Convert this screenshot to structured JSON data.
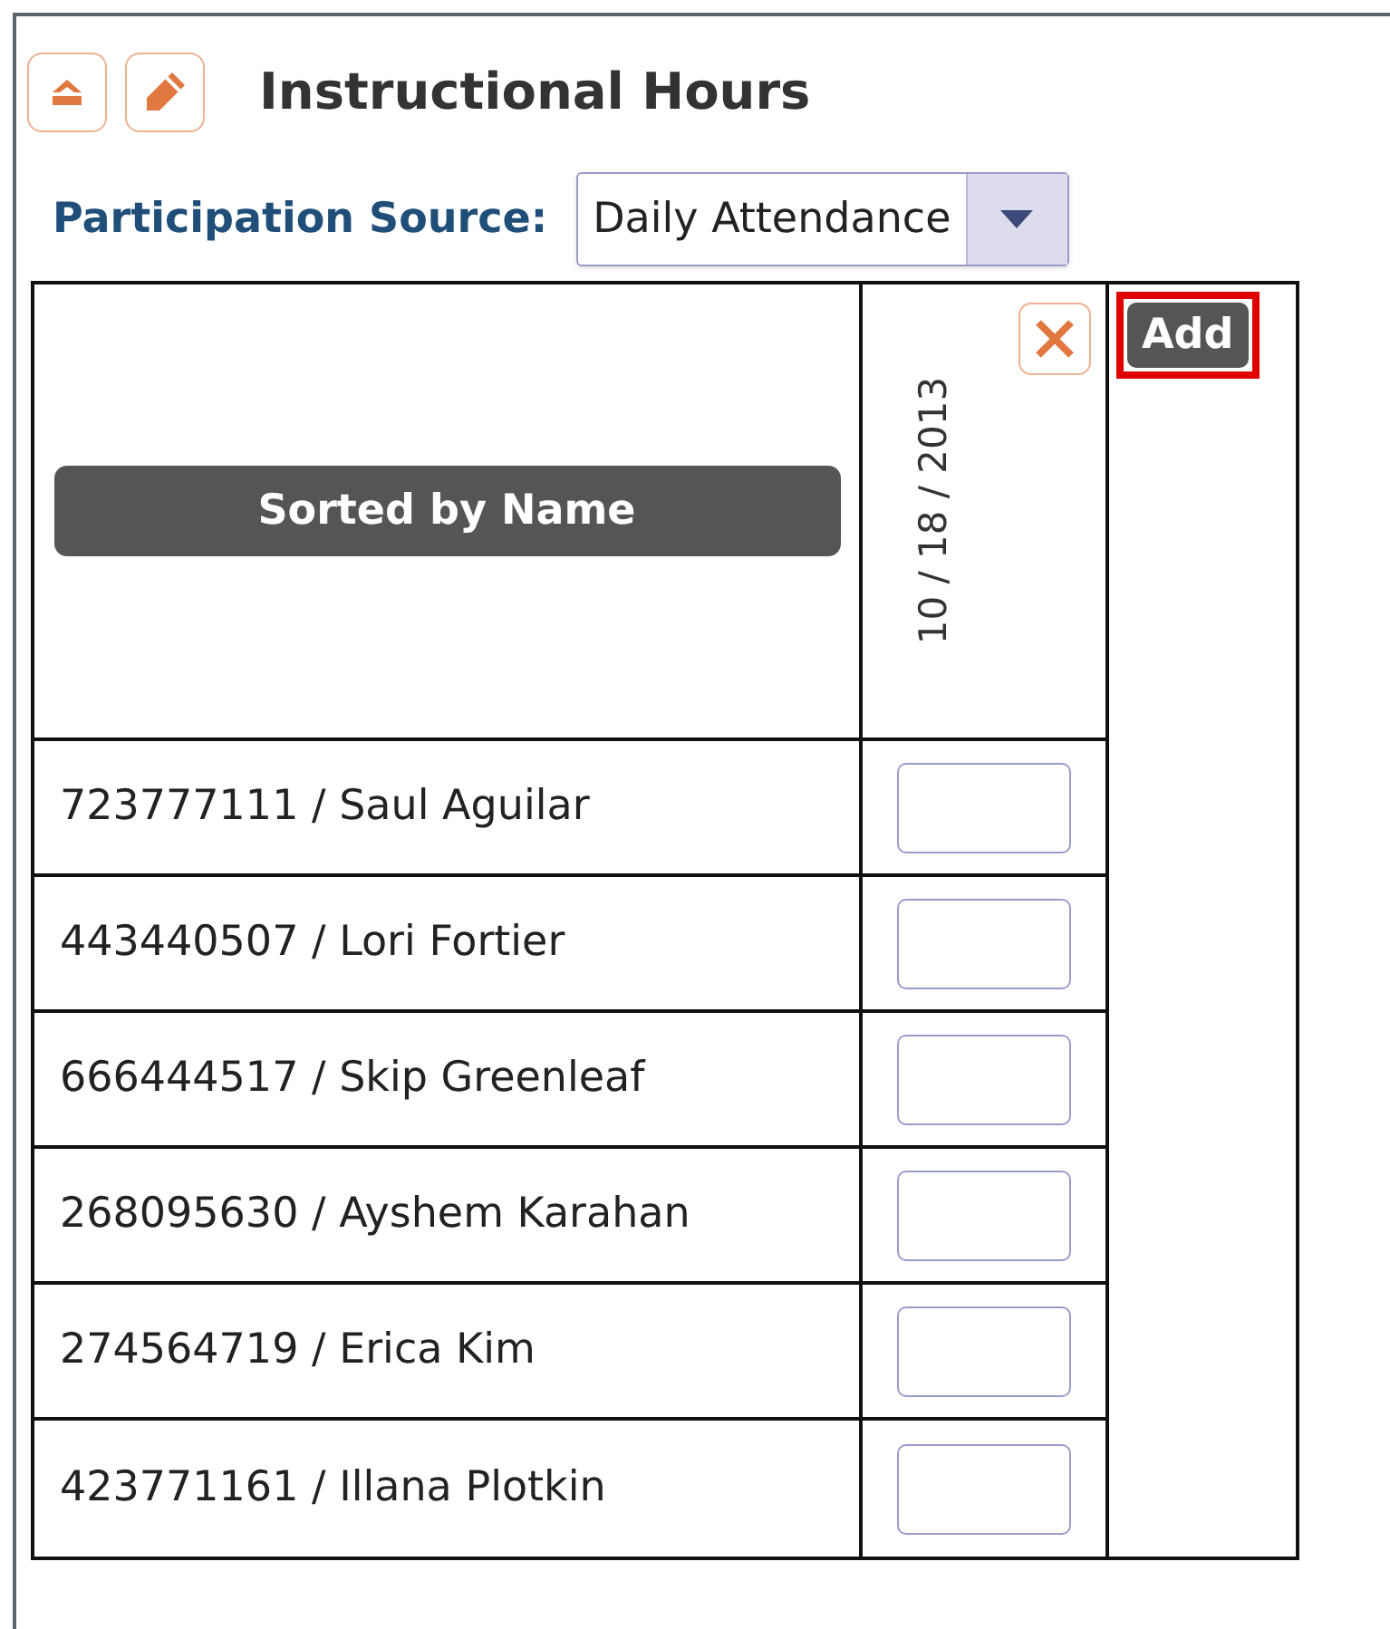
{
  "header": {
    "title": "Instructional Hours"
  },
  "participation_source": {
    "label": "Participation Source:",
    "value": "Daily Attendance"
  },
  "table": {
    "sort_label": "Sorted by Name",
    "date_column": "10 / 18 / 2013",
    "add_button": {
      "label": "Add",
      "highlighted": true
    },
    "rows": [
      {
        "student": "723777111 / Saul Aguilar"
      },
      {
        "student": "443440507 / Lori Fortier"
      },
      {
        "student": "666444517 / Skip Greenleaf"
      },
      {
        "student": "268095630 / Ayshem Karahan"
      },
      {
        "student": "274564719 / Erica Kim"
      },
      {
        "student": "423771161 / Illana Plotkin"
      }
    ]
  }
}
